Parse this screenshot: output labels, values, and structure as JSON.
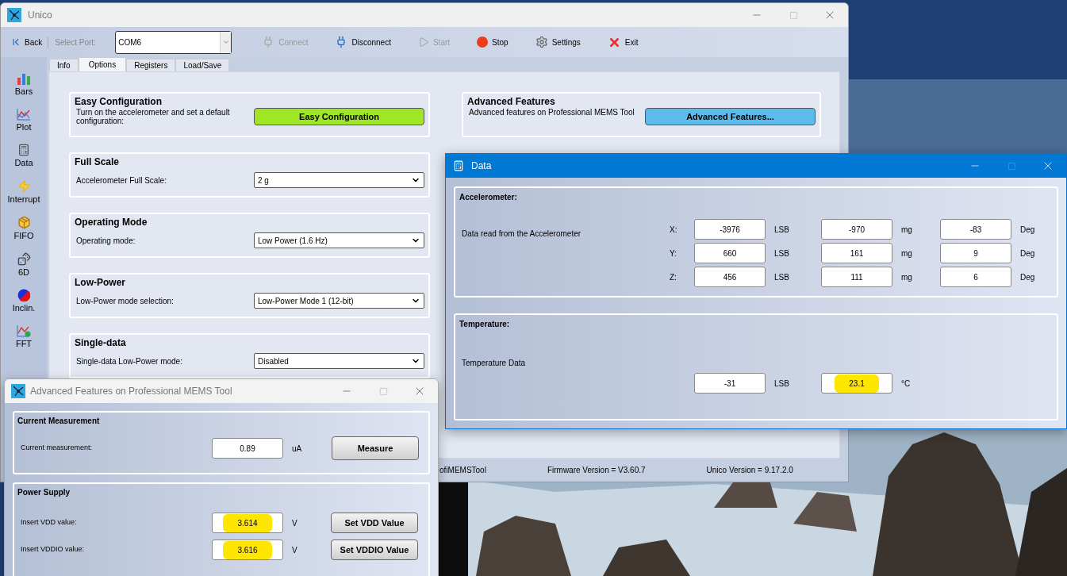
{
  "main_window": {
    "title": "Unico",
    "toolbar": {
      "back": "Back",
      "port_label": "Select Port:",
      "port_value": "COM6",
      "buttons": [
        {
          "label": "Connect",
          "disabled": true
        },
        {
          "label": "Disconnect",
          "disabled": false
        },
        {
          "label": "Start",
          "disabled": true
        },
        {
          "label": "Stop",
          "disabled": false
        },
        {
          "label": "Settings",
          "disabled": false
        },
        {
          "label": "Exit",
          "disabled": false
        }
      ]
    },
    "tabs": [
      {
        "label": "Info",
        "selected": false
      },
      {
        "label": "Options",
        "selected": true
      },
      {
        "label": "Registers",
        "selected": false
      },
      {
        "label": "Load/Save",
        "selected": false
      }
    ],
    "sidebar": {
      "items": [
        {
          "label": "Bars"
        },
        {
          "label": "Plot"
        },
        {
          "label": "Data"
        },
        {
          "label": "Interrupt"
        },
        {
          "label": "FIFO"
        },
        {
          "label": "6D"
        },
        {
          "label": "Inclin."
        },
        {
          "label": "FFT"
        }
      ]
    },
    "left_groups": [
      {
        "title": "Easy Configuration",
        "label": "Turn on the accelerometer and set a default configuration:",
        "kind": "button",
        "value": "Easy Configuration",
        "color": "#9fe627"
      },
      {
        "title": "Full Scale",
        "label": "Accelerometer Full Scale:",
        "kind": "dropdown",
        "value": "2 g"
      },
      {
        "title": "Operating Mode",
        "label": "Operating mode:",
        "kind": "dropdown",
        "value": "Low Power (1.6 Hz)"
      },
      {
        "title": "Low-Power",
        "label": "Low-Power mode selection:",
        "kind": "dropdown",
        "value": "Low-Power Mode 1 (12-bit)"
      },
      {
        "title": "Single-data",
        "label": "Single-data Low-Power mode:",
        "kind": "dropdown",
        "value": "Disabled"
      }
    ],
    "right_groups": [
      {
        "title": "Advanced Features",
        "label": "Advanced features on Professional MEMS Tool",
        "kind": "button",
        "value": "Advanced Features...",
        "color": "#5cbbea"
      }
    ],
    "status_bar": [
      "ofiMEMSTool",
      "Firmware Version = V3.60.7",
      "Unico Version = 9.17.2.0"
    ]
  },
  "data_window": {
    "title": "Data",
    "accelerometer": {
      "title": "Accelerometer:",
      "description": "Data read from the Accelerometer",
      "rows": [
        {
          "axis": "X:",
          "lsb": "-3976",
          "lsb_unit": "LSB",
          "mg": "-970",
          "mg_unit": "mg",
          "deg": "-83",
          "deg_unit": "Deg"
        },
        {
          "axis": "Y:",
          "lsb": "660",
          "lsb_unit": "LSB",
          "mg": "161",
          "mg_unit": "mg",
          "deg": "9",
          "deg_unit": "Deg"
        },
        {
          "axis": "Z:",
          "lsb": "456",
          "lsb_unit": "LSB",
          "mg": "111",
          "mg_unit": "mg",
          "deg": "6",
          "deg_unit": "Deg"
        }
      ]
    },
    "temperature": {
      "title": "Temperature:",
      "description": "Temperature Data",
      "fields": [
        {
          "value": "-31",
          "unit": "LSB",
          "highlighted": false
        },
        {
          "value": "23.1",
          "unit": "°C",
          "highlighted": true
        }
      ]
    }
  },
  "advanced_window": {
    "title": "Advanced Features on Professional MEMS Tool",
    "current": {
      "title": "Current Measurement",
      "label": "Current measurement:",
      "value": "0.89",
      "unit": "uA",
      "button": "Measure",
      "highlighted": false
    },
    "power_supply": {
      "title": "Power Supply",
      "rows": [
        {
          "label": "Insert VDD value:",
          "value": "3.614",
          "unit": "V",
          "button": "Set VDD Value",
          "highlighted": true
        },
        {
          "label": "Insert VDDIO value:",
          "value": "3.616",
          "unit": "V",
          "button": "Set VDDIO Value",
          "highlighted": true
        }
      ]
    }
  }
}
